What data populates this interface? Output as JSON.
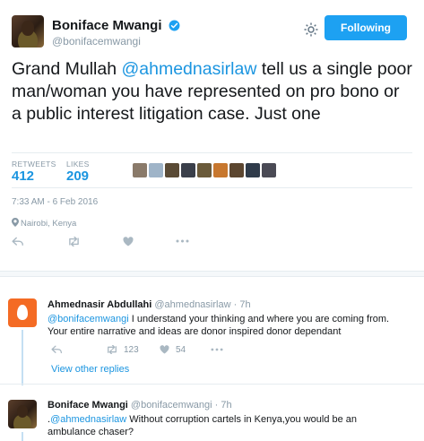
{
  "tweet": {
    "author_name": "Boniface Mwangi",
    "author_handle": "@bonifacemwangi",
    "follow_label": "Following",
    "text_before": "Grand Mullah ",
    "text_mention": "@ahmednasirlaw",
    "text_after": " tell us a single poor man/woman you have represented on pro bono or a public interest litigation case. Just one",
    "retweets_label": "RETWEETS",
    "retweets_count": "412",
    "likes_label": "LIKES",
    "likes_count": "209",
    "timestamp": "7:33 AM - 6 Feb 2016",
    "location": "Nairobi, Kenya",
    "liker_colors": [
      "#8a7a6a",
      "#9fb4c8",
      "#5a4a35",
      "#3a3f4a",
      "#6a5a3a",
      "#c7772e",
      "#5c4630",
      "#2f3b4a",
      "#4a4a55"
    ]
  },
  "replies": [
    {
      "name": "Ahmednasir Abdullahi",
      "handle": "@ahmednasirlaw",
      "time": "· 7h",
      "mention": "@bonifacemwangi",
      "text": " I understand your thinking and where you are coming from. Your entire narrative and ideas are donor inspired donor dependant",
      "retweet_count": "123",
      "like_count": "54",
      "view_other": "View other replies"
    },
    {
      "name": "Boniface Mwangi",
      "handle": "@bonifacemwangi",
      "time": "· 7h",
      "prefix": ".",
      "mention": "@ahmednasirlaw",
      "text": " Without corruption cartels in Kenya,you would be an ambulance chaser?"
    }
  ]
}
